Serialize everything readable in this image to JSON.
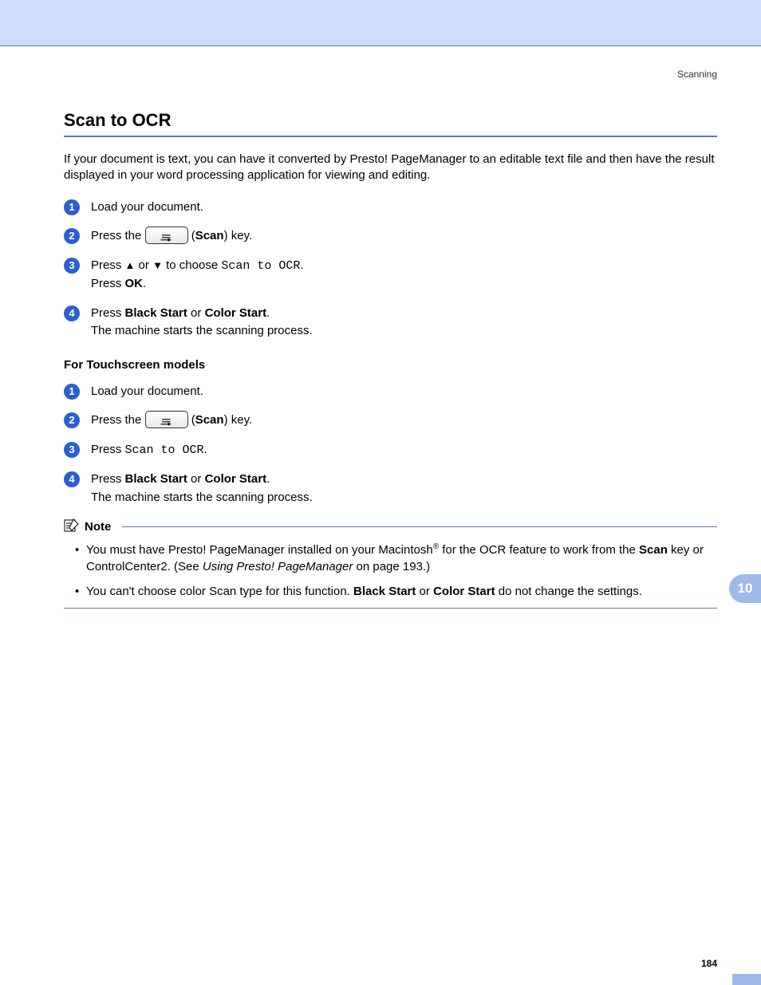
{
  "running_head": "Scanning",
  "title": "Scan to OCR",
  "intro": "If your document is text, you can have it converted by Presto! PageManager to an editable text file and then have the result displayed in your word processing application for viewing and editing.",
  "steps": {
    "s1": "Load your document.",
    "s2_pre": "Press the ",
    "s2_post_open": " (",
    "s2_scan": "Scan",
    "s2_post_close": ") key.",
    "s3_pre": "Press ",
    "s3_up": "▲",
    "s3_mid": " or ",
    "s3_down": "▼",
    "s3_choose": " to choose ",
    "s3_mono": "Scan to OCR",
    "s3_period": ".",
    "s3_line2_pre": "Press ",
    "s3_ok": "OK",
    "s3_line2_post": ".",
    "s4_pre": "Press ",
    "s4_black": "Black Start",
    "s4_or": " or ",
    "s4_color": "Color Start",
    "s4_post": ".",
    "s4_line2": "The machine starts the scanning process."
  },
  "touch_heading": "For Touchscreen models",
  "touch": {
    "t3_pre": "Press ",
    "t3_mono": "Scan to OCR",
    "t3_post": "."
  },
  "note": {
    "label": "Note",
    "n1_a": "You must have Presto! PageManager installed on your Macintosh",
    "n1_reg": "®",
    "n1_b": " for the OCR feature to work from the ",
    "n1_scan": "Scan",
    "n1_c": " key or ControlCenter2. (See ",
    "n1_link": "Using Presto! PageManager",
    "n1_d": " on page 193.)",
    "n2_a": "You can't choose color Scan type for this function. ",
    "n2_black": "Black Start",
    "n2_or": " or ",
    "n2_color": "Color Start",
    "n2_b": " do not change the settings."
  },
  "chapter_tab": "10",
  "page_number": "184"
}
